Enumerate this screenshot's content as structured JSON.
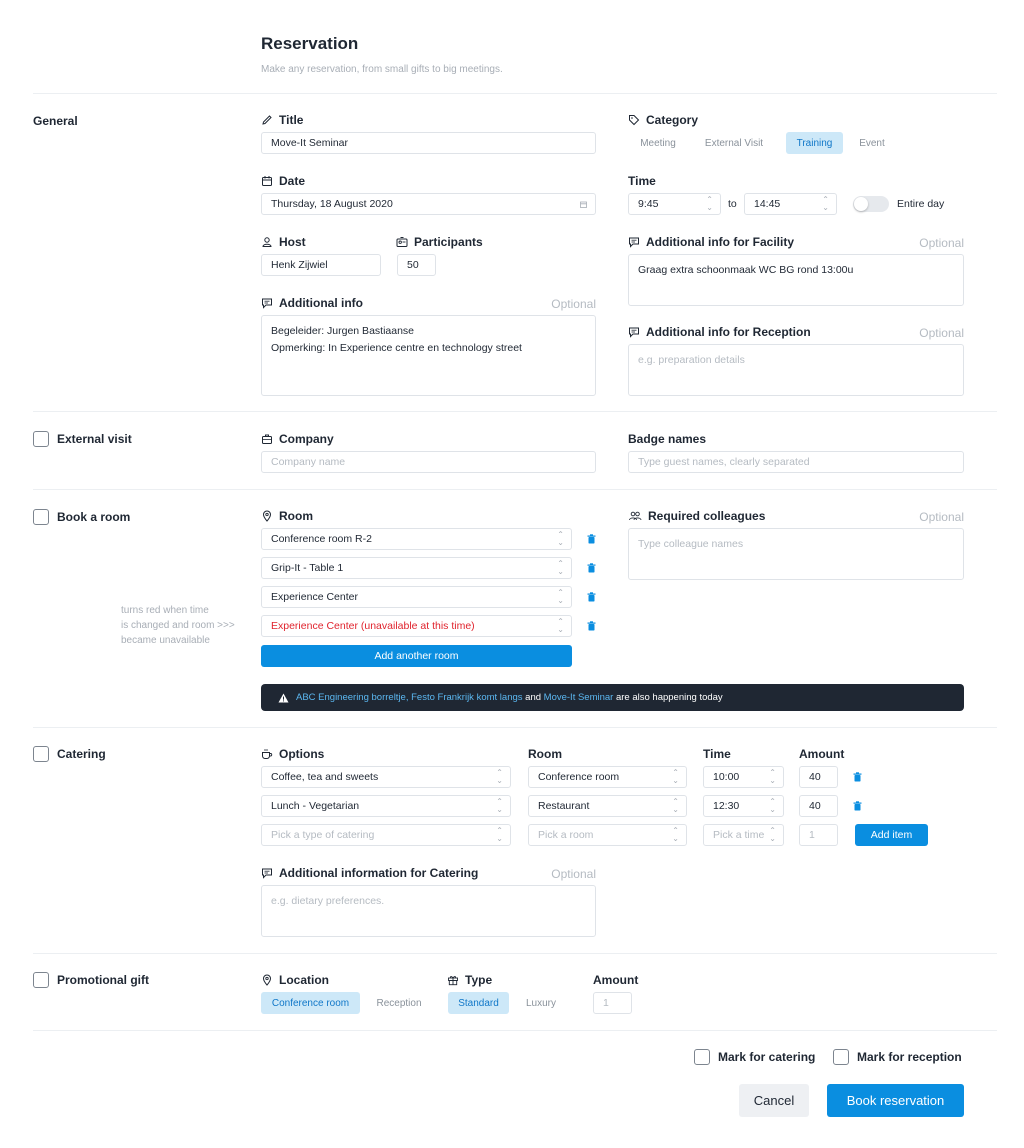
{
  "header": {
    "title": "Reservation",
    "subtitle": "Make any reservation, from small gifts to big meetings."
  },
  "general": {
    "section_label": "General",
    "title_label": "Title",
    "title_value": "Move-It Seminar",
    "category_label": "Category",
    "categories": [
      "Meeting",
      "External Visit",
      "Training",
      "Event"
    ],
    "category_selected": "Training",
    "date_label": "Date",
    "date_value": "Thursday, 18 August 2020",
    "time_label": "Time",
    "time_from": "9:45",
    "time_to_word": "to",
    "time_to": "14:45",
    "entire_day_label": "Entire day",
    "host_label": "Host",
    "host_value": "Henk Zijwiel",
    "participants_label": "Participants",
    "participants_value": "50",
    "facility_info_label": "Additional info for Facility",
    "facility_info_value": "Graag extra schoonmaak WC BG rond 13:00u",
    "additional_info_label": "Additional info",
    "additional_info_value": "Begeleider: Jurgen Bastiaanse\nOpmerking: In Experience centre en technology street",
    "reception_info_label": "Additional info for Reception",
    "reception_info_placeholder": "e.g. preparation details",
    "optional_label": "Optional"
  },
  "external_visit": {
    "section_label": "External visit",
    "company_label": "Company",
    "company_placeholder": "Company name",
    "badge_label": "Badge names",
    "badge_placeholder": "Type guest names, clearly separated"
  },
  "room": {
    "section_label": "Book a room",
    "room_label": "Room",
    "rooms": [
      "Conference room R-2",
      "Grip-It - Table 1",
      "Experience Center",
      "Experience Center (unavailable at this time)"
    ],
    "add_room_label": "Add another room",
    "colleagues_label": "Required colleagues",
    "colleagues_placeholder": "Type colleague names",
    "note_lines": [
      "turns red when time",
      "is changed and room >>>",
      "became unavailable"
    ],
    "banner": {
      "event1": "ABC Engineering borreltje, Festo Frankrijk komt langs",
      "and_word": " and ",
      "event2": "Move-It Seminar",
      "suffix": " are also happening today"
    }
  },
  "catering": {
    "section_label": "Catering",
    "options_label": "Options",
    "room_label": "Room",
    "time_label": "Time",
    "amount_label": "Amount",
    "rows": [
      {
        "option": "Coffee, tea and sweets",
        "room": "Conference room",
        "time": "10:00",
        "amount": "40"
      },
      {
        "option": "Lunch - Vegetarian",
        "room": "Restaurant",
        "time": "12:30",
        "amount": "40"
      }
    ],
    "new_row": {
      "option_placeholder": "Pick a type of catering",
      "room_placeholder": "Pick a room",
      "time_placeholder": "Pick a time",
      "amount_placeholder": "1"
    },
    "add_item_label": "Add item",
    "info_label": "Additional information for Catering",
    "info_placeholder": "e.g. dietary preferences."
  },
  "gift": {
    "section_label": "Promotional gift",
    "location_label": "Location",
    "locations": [
      "Conference room",
      "Reception"
    ],
    "location_selected": "Conference room",
    "type_label": "Type",
    "types": [
      "Standard",
      "Luxury"
    ],
    "type_selected": "Standard",
    "amount_label": "Amount",
    "amount_placeholder": "1"
  },
  "footer": {
    "mark_catering_label": "Mark for catering",
    "mark_reception_label": "Mark for reception",
    "cancel_label": "Cancel",
    "book_label": "Book reservation"
  },
  "colors": {
    "accent": "#0a8ee0",
    "selected_pill_bg": "#cde8f8",
    "error_text": "#e0242e",
    "banner_bg": "#1f2733"
  }
}
